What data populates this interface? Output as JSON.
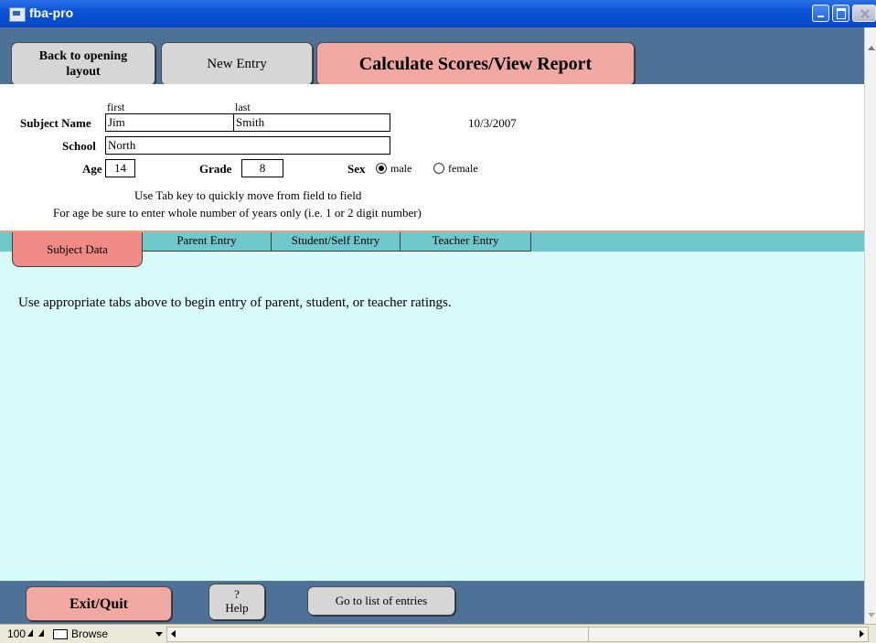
{
  "window": {
    "title": "fba-pro"
  },
  "header": {
    "back_label_line1": "Back to opening",
    "back_label_line2": "layout",
    "new_entry_label": "New Entry",
    "calculate_label": "Calculate Scores/View Report"
  },
  "form": {
    "first_caption": "first",
    "last_caption": "last",
    "subject_name_label": "Subject Name",
    "first_name": "Jim",
    "last_name": "Smith",
    "date": "10/3/2007",
    "school_label": "School",
    "school": "North",
    "age_label": "Age",
    "age": "14",
    "grade_label": "Grade",
    "grade": "8",
    "sex_label": "Sex",
    "sex_options": [
      "male",
      "female"
    ],
    "sex_selected": "male",
    "hint1": "Use Tab key to quickly move from field to field",
    "hint2": "For age be sure to enter whole number of years only (i.e. 1 or 2 digit number)"
  },
  "tabs": [
    {
      "label": "Subject Data",
      "active": true
    },
    {
      "label": "Parent Entry",
      "active": false
    },
    {
      "label": "Student/Self Entry",
      "active": false
    },
    {
      "label": "Teacher Entry",
      "active": false
    }
  ],
  "panel": {
    "message": "Use appropriate tabs above to begin entry of parent, student, or teacher ratings."
  },
  "footer": {
    "exit_label": "Exit/Quit",
    "help_symbol": "?",
    "help_label": "Help",
    "goto_label": "Go to list of entries"
  },
  "status": {
    "zoom": "100",
    "mode": "Browse"
  },
  "colors": {
    "header_bg": "#4d7197",
    "pink_button": "#f1a7a2",
    "tab_bg": "#6fc8cc",
    "active_tab": "#f08a85",
    "panel_bg": "#d7fafb"
  }
}
